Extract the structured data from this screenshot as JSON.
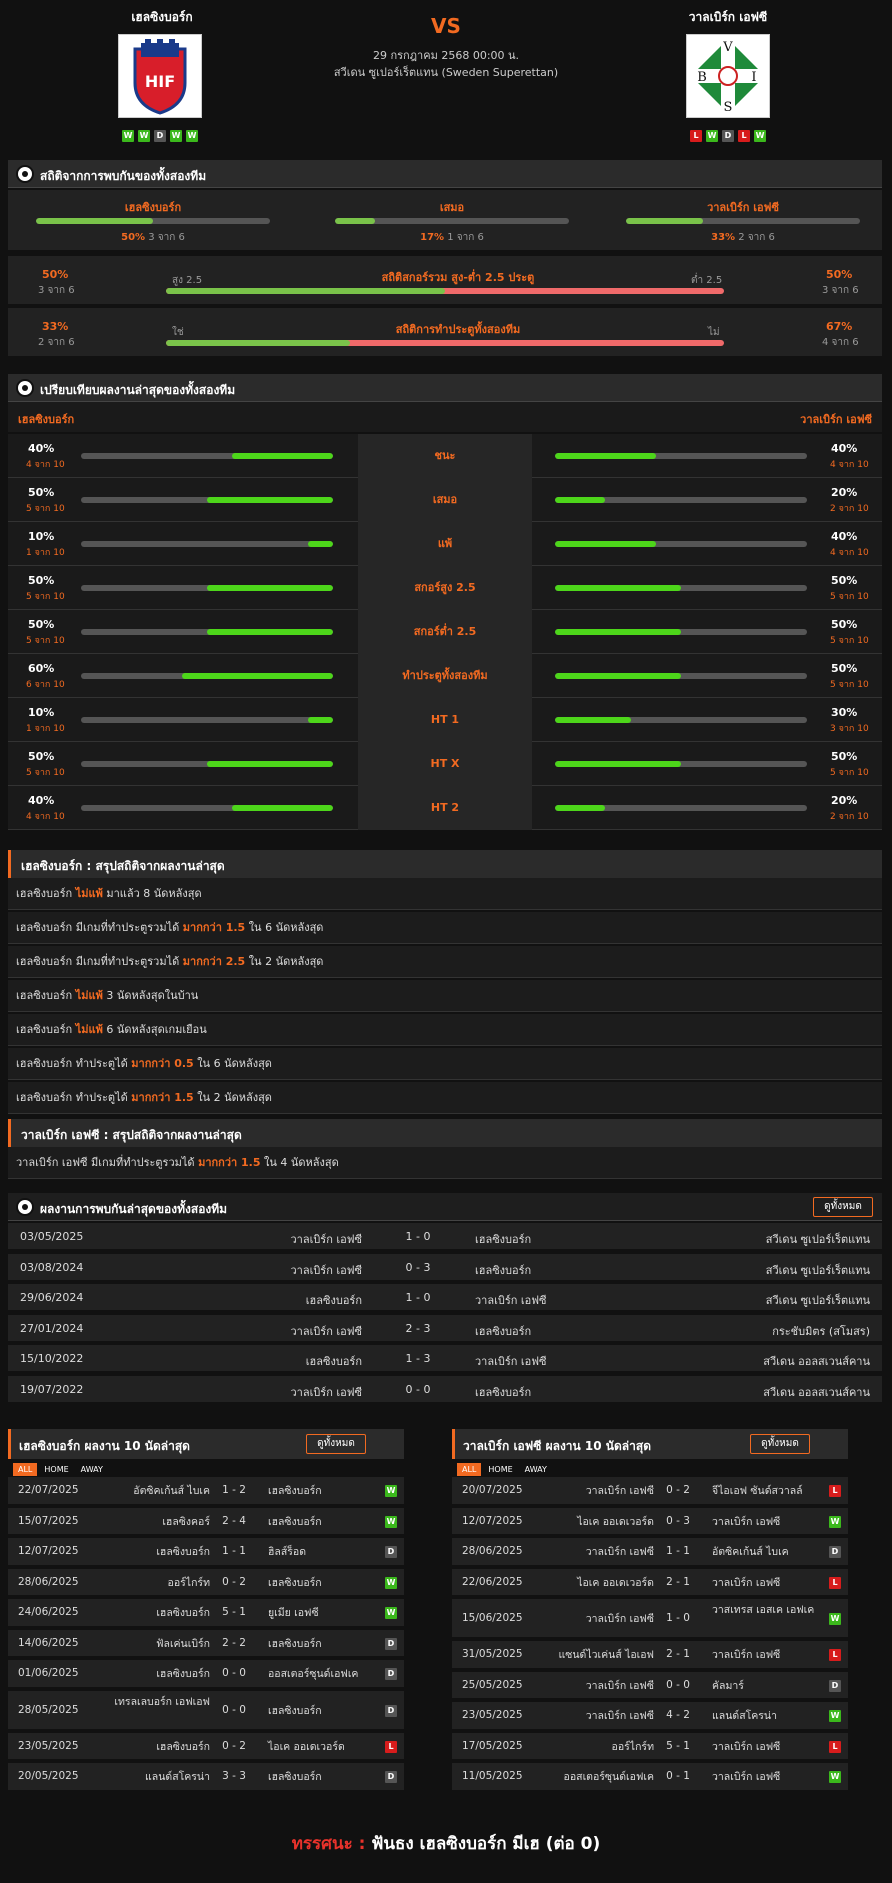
{
  "header": {
    "home_name": "เฮลซิงบอร์ก",
    "away_name": "วาลเบิร์ก เอฟซี",
    "vs": "VS",
    "datetime": "29 กรกฎาคม 2568 00:00 น.",
    "league": "สวีเดน ซูเปอร์เร็ตแทน (Sweden Superettan)",
    "home_form": [
      "W",
      "W",
      "D",
      "W",
      "W"
    ],
    "away_form": [
      "L",
      "W",
      "D",
      "L",
      "W"
    ]
  },
  "h2h_stats": {
    "title": "สถิติจากการพบกันของทั้งสองทีม",
    "items": [
      {
        "label": "เฮลซิงบอร์ก",
        "pct": "50%",
        "count": "3 จาก 6",
        "value": 0.5
      },
      {
        "label": "เสมอ",
        "pct": "17%",
        "count": "1 จาก 6",
        "value": 0.17
      },
      {
        "label": "วาลเบิร์ก เอฟซี",
        "pct": "33%",
        "count": "2 จาก 6",
        "value": 0.33
      }
    ],
    "ou": {
      "title": "สถิติสกอร์รวม สูง-ต่ำ 2.5 ประตู",
      "left_label": "สูง 2.5",
      "right_label": "ต่ำ 2.5",
      "left_pct": "50%",
      "left_count": "3 จาก 6",
      "right_pct": "50%",
      "right_count": "3 จาก 6",
      "value": 0.5
    },
    "btts": {
      "title": "สถิติการทำประตูทั้งสองทีม",
      "left_label": "ใช่",
      "right_label": "ไม่",
      "left_pct": "33%",
      "left_count": "2 จาก 6",
      "right_pct": "67%",
      "right_count": "4 จาก 6",
      "value": 0.33
    }
  },
  "compare": {
    "title": "เปรียบเทียบผลงานล่าสุดของทั้งสองทีม",
    "home": "เฮลซิงบอร์ก",
    "away": "วาลเบิร์ก เอฟซี",
    "rows": [
      {
        "label": "ชนะ",
        "hp": "40%",
        "hc": "4 จาก 10",
        "hv": 0.4,
        "ap": "40%",
        "ac": "4 จาก 10",
        "av": 0.4
      },
      {
        "label": "เสมอ",
        "hp": "50%",
        "hc": "5 จาก 10",
        "hv": 0.5,
        "ap": "20%",
        "ac": "2 จาก 10",
        "av": 0.2
      },
      {
        "label": "แพ้",
        "hp": "10%",
        "hc": "1 จาก 10",
        "hv": 0.1,
        "ap": "40%",
        "ac": "4 จาก 10",
        "av": 0.4
      },
      {
        "label": "สกอร์สูง 2.5",
        "hp": "50%",
        "hc": "5 จาก 10",
        "hv": 0.5,
        "ap": "50%",
        "ac": "5 จาก 10",
        "av": 0.5
      },
      {
        "label": "สกอร์ต่ำ 2.5",
        "hp": "50%",
        "hc": "5 จาก 10",
        "hv": 0.5,
        "ap": "50%",
        "ac": "5 จาก 10",
        "av": 0.5
      },
      {
        "label": "ทำประตูทั้งสองทีม",
        "hp": "60%",
        "hc": "6 จาก 10",
        "hv": 0.6,
        "ap": "50%",
        "ac": "5 จาก 10",
        "av": 0.5
      },
      {
        "label": "HT 1",
        "hp": "10%",
        "hc": "1 จาก 10",
        "hv": 0.1,
        "ap": "30%",
        "ac": "3 จาก 10",
        "av": 0.3
      },
      {
        "label": "HT X",
        "hp": "50%",
        "hc": "5 จาก 10",
        "hv": 0.5,
        "ap": "50%",
        "ac": "5 จาก 10",
        "av": 0.5
      },
      {
        "label": "HT 2",
        "hp": "40%",
        "hc": "4 จาก 10",
        "hv": 0.4,
        "ap": "20%",
        "ac": "2 จาก 10",
        "av": 0.2
      }
    ]
  },
  "home_summary": {
    "title": "เฮลซิงบอร์ก : สรุปสถิติจากผลงานล่าสุด",
    "rows": [
      {
        "a": "เฮลซิงบอร์ก",
        "b": "ไม่แพ้",
        "c": "มาแล้ว 8 นัดหลังสุด"
      },
      {
        "a": "เฮลซิงบอร์ก มีเกมที่ทำประตูรวมได้",
        "b": "มากกว่า 1.5",
        "c": "ใน 6 นัดหลังสุด"
      },
      {
        "a": "เฮลซิงบอร์ก มีเกมที่ทำประตูรวมได้",
        "b": "มากกว่า 2.5",
        "c": "ใน 2 นัดหลังสุด"
      },
      {
        "a": "เฮลซิงบอร์ก",
        "b": "ไม่แพ้",
        "c": "3 นัดหลังสุดในบ้าน"
      },
      {
        "a": "เฮลซิงบอร์ก",
        "b": "ไม่แพ้",
        "c": "6 นัดหลังสุดเกมเยือน"
      },
      {
        "a": "เฮลซิงบอร์ก ทำประตูได้",
        "b": "มากกว่า 0.5",
        "c": "ใน 6 นัดหลังสุด"
      },
      {
        "a": "เฮลซิงบอร์ก ทำประตูได้",
        "b": "มากกว่า 1.5",
        "c": "ใน 2 นัดหลังสุด"
      }
    ]
  },
  "away_summary": {
    "title": "วาลเบิร์ก เอฟซี : สรุปสถิติจากผลงานล่าสุด",
    "rows": [
      {
        "a": "วาลเบิร์ก เอฟซี มีเกมที่ทำประตูรวมได้",
        "b": "มากกว่า 1.5",
        "c": "ใน 4 นัดหลังสุด"
      }
    ]
  },
  "h2h_results": {
    "title": "ผลงานการพบกันล่าสุดของทั้งสองทีม",
    "view_all": "ดูทั้งหมด",
    "rows": [
      {
        "date": "03/05/2025",
        "home": "วาลเบิร์ก เอฟซี",
        "score": "1 - 0",
        "away": "เฮลซิงบอร์ก",
        "league": "สวีเดน ซูเปอร์เร็ตแทน"
      },
      {
        "date": "03/08/2024",
        "home": "วาลเบิร์ก เอฟซี",
        "score": "0 - 3",
        "away": "เฮลซิงบอร์ก",
        "league": "สวีเดน ซูเปอร์เร็ตแทน"
      },
      {
        "date": "29/06/2024",
        "home": "เฮลซิงบอร์ก",
        "score": "1 - 0",
        "away": "วาลเบิร์ก เอฟซี",
        "league": "สวีเดน ซูเปอร์เร็ตแทน"
      },
      {
        "date": "27/01/2024",
        "home": "วาลเบิร์ก เอฟซี",
        "score": "2 - 3",
        "away": "เฮลซิงบอร์ก",
        "league": "กระชับมิตร (สโมสร)"
      },
      {
        "date": "15/10/2022",
        "home": "เฮลซิงบอร์ก",
        "score": "1 - 3",
        "away": "วาลเบิร์ก เอฟซี",
        "league": "สวีเดน ออลสเวนส์คาน"
      },
      {
        "date": "19/07/2022",
        "home": "วาลเบิร์ก เอฟซี",
        "score": "0 - 0",
        "away": "เฮลซิงบอร์ก",
        "league": "สวีเดน ออลสเวนส์คาน"
      }
    ]
  },
  "home_last10": {
    "title": "เฮลซิงบอร์ก ผลงาน 10 นัดล่าสุด",
    "view_all": "ดูทั้งหมด",
    "tabs": [
      "ALL",
      "HOME",
      "AWAY"
    ],
    "rows": [
      {
        "date": "22/07/2025",
        "home": "อัตซิคเก้นส์ ไบเค",
        "score": "1 - 2",
        "away": "เฮลซิงบอร์ก",
        "res": "W"
      },
      {
        "date": "15/07/2025",
        "home": "เฮลซิงคอร์",
        "score": "2 - 4",
        "away": "เฮลซิงบอร์ก",
        "res": "W"
      },
      {
        "date": "12/07/2025",
        "home": "เฮลซิงบอร์ก",
        "score": "1 - 1",
        "away": "ฮิลส์ร็อด",
        "res": "D"
      },
      {
        "date": "28/06/2025",
        "home": "ออร์ไกร์ท",
        "score": "0 - 2",
        "away": "เฮลซิงบอร์ก",
        "res": "W"
      },
      {
        "date": "24/06/2025",
        "home": "เฮลซิงบอร์ก",
        "score": "5 - 1",
        "away": "ยูเมีย เอฟซี",
        "res": "W"
      },
      {
        "date": "14/06/2025",
        "home": "ฟัลเค่นเบิร์ก",
        "score": "2 - 2",
        "away": "เฮลซิงบอร์ก",
        "res": "D"
      },
      {
        "date": "01/06/2025",
        "home": "เฮลซิงบอร์ก",
        "score": "0 - 0",
        "away": "ออสเตอร์ซุนด์เอฟเค",
        "res": "D"
      },
      {
        "date": "28/05/2025",
        "home": "เทรลเลบอร์ก เอฟเอฟ",
        "score": "0 - 0",
        "away": "เฮลซิงบอร์ก",
        "res": "D"
      },
      {
        "date": "23/05/2025",
        "home": "เฮลซิงบอร์ก",
        "score": "0 - 2",
        "away": "ไอเค ออเดเวอร์ด",
        "res": "L"
      },
      {
        "date": "20/05/2025",
        "home": "แลนด์สโครน่า",
        "score": "3 - 3",
        "away": "เฮลซิงบอร์ก",
        "res": "D"
      }
    ]
  },
  "away_last10": {
    "title": "วาลเบิร์ก เอฟซี ผลงาน 10 นัดล่าสุด",
    "view_all": "ดูทั้งหมด",
    "tabs": [
      "ALL",
      "HOME",
      "AWAY"
    ],
    "rows": [
      {
        "date": "20/07/2025",
        "home": "วาลเบิร์ก เอฟซี",
        "score": "0 - 2",
        "away": "จีไอเอฟ ซันด์สวาลล์",
        "res": "L"
      },
      {
        "date": "12/07/2025",
        "home": "ไอเค ออเดเวอร์ด",
        "score": "0 - 3",
        "away": "วาลเบิร์ก เอฟซี",
        "res": "W"
      },
      {
        "date": "28/06/2025",
        "home": "วาลเบิร์ก เอฟซี",
        "score": "1 - 1",
        "away": "อัตซิคเก้นส์ ไบเค",
        "res": "D"
      },
      {
        "date": "22/06/2025",
        "home": "ไอเค ออเดเวอร์ด",
        "score": "2 - 1",
        "away": "วาลเบิร์ก เอฟซี",
        "res": "L"
      },
      {
        "date": "15/06/2025",
        "home": "วาลเบิร์ก เอฟซี",
        "score": "1 - 0",
        "away": "วาสเทรส เอสเค เอฟเค",
        "res": "W"
      },
      {
        "date": "31/05/2025",
        "home": "แซนด์ไวเค่นส์ ไอเอฟ",
        "score": "2 - 1",
        "away": "วาลเบิร์ก เอฟซี",
        "res": "L"
      },
      {
        "date": "25/05/2025",
        "home": "วาลเบิร์ก เอฟซี",
        "score": "0 - 0",
        "away": "คัลมาร์",
        "res": "D"
      },
      {
        "date": "23/05/2025",
        "home": "วาลเบิร์ก เอฟซี",
        "score": "4 - 2",
        "away": "แลนด์สโครน่า",
        "res": "W"
      },
      {
        "date": "17/05/2025",
        "home": "ออร์ไกร์ท",
        "score": "5 - 1",
        "away": "วาลเบิร์ก เอฟซี",
        "res": "L"
      },
      {
        "date": "11/05/2025",
        "home": "ออสเตอร์ซุนด์เอฟเค",
        "score": "0 - 1",
        "away": "วาลเบิร์ก เอฟซี",
        "res": "W"
      }
    ]
  },
  "prediction": {
    "label": "ทรรศนะ :",
    "text": "ฟันธง เฮลซิงบอร์ก มีเฮ (ต่อ 0)"
  },
  "colors": {
    "accent": "#f26a21",
    "win": "#3bb81c",
    "draw": "#555555",
    "loss": "#d71c1c"
  }
}
